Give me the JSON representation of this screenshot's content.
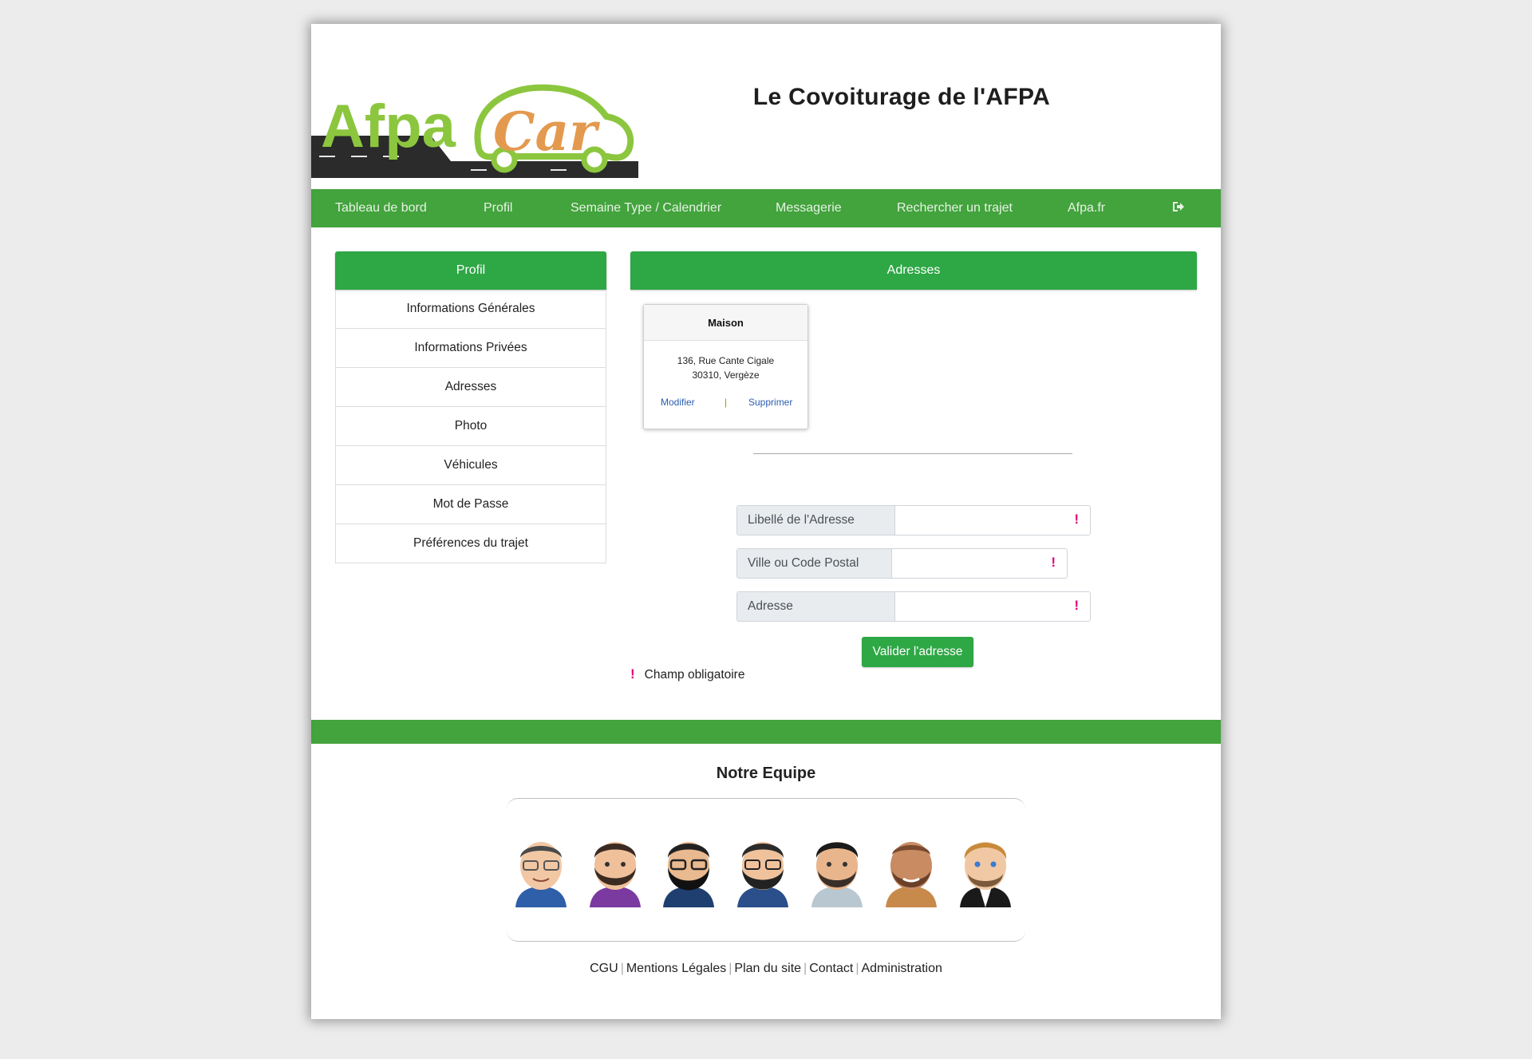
{
  "header": {
    "logo_text_1": "Afpa",
    "logo_text_2": "Car",
    "title": "Le Covoiturage de l'AFPA"
  },
  "nav": {
    "items": [
      "Tableau de bord",
      "Profil",
      "Semaine Type / Calendrier",
      "Messagerie",
      "Rechercher un trajet",
      "Afpa.fr"
    ],
    "logout_icon": "sign-out-icon"
  },
  "sidebar": {
    "title": "Profil",
    "items": [
      "Informations Générales",
      "Informations Privées",
      "Adresses",
      "Photo",
      "Véhicules",
      "Mot de Passe",
      "Préférences du trajet"
    ]
  },
  "addresses": {
    "title": "Adresses",
    "card": {
      "name": "Maison",
      "line1": "136, Rue Cante Cigale",
      "line2": "30310, Vergèze",
      "edit": "Modifier",
      "separator": "|",
      "delete": "Supprimer"
    },
    "form": {
      "label_field": "Libellé de l'Adresse",
      "city_field": "Ville ou Code Postal",
      "address_field": "Adresse",
      "required_mark": "!",
      "submit": "Valider l'adresse"
    },
    "legend": "Champ obligatoire"
  },
  "footer": {
    "team_title": "Notre Equipe",
    "links": [
      "CGU",
      "Mentions Légales",
      "Plan du site",
      "Contact",
      "Administration"
    ]
  },
  "colors": {
    "brand_green": "#43a33d",
    "button_green": "#2ea745",
    "logo_green": "#8cc63f",
    "logo_orange": "#e39a4f",
    "required": "#e0007a"
  }
}
